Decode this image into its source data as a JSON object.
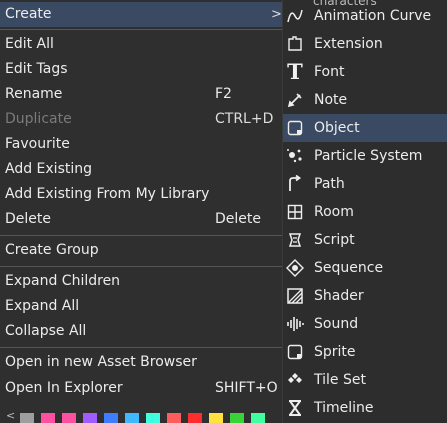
{
  "main_menu": {
    "create": "Create",
    "edit_all": "Edit All",
    "edit_tags": "Edit Tags",
    "rename": "Rename",
    "rename_sc": "F2",
    "duplicate": "Duplicate",
    "duplicate_sc": "CTRL+D",
    "favourite": "Favourite",
    "add_existing": "Add Existing",
    "add_existing_lib": "Add Existing From My Library",
    "delete": "Delete",
    "delete_sc": "Delete",
    "create_group": "Create Group",
    "expand_children": "Expand Children",
    "expand_all": "Expand All",
    "collapse_all": "Collapse All",
    "open_browser": "Open in new Asset Browser",
    "open_explorer": "Open In Explorer",
    "open_explorer_sc": "SHIFT+O"
  },
  "submenu_top_cut": "characters",
  "submenu": [
    {
      "label": "Animation Curve",
      "icon": "animation-curve-icon"
    },
    {
      "label": "Extension",
      "icon": "extension-icon"
    },
    {
      "label": "Font",
      "icon": "font-icon"
    },
    {
      "label": "Note",
      "icon": "note-icon"
    },
    {
      "label": "Object",
      "icon": "object-icon"
    },
    {
      "label": "Particle System",
      "icon": "particle-system-icon"
    },
    {
      "label": "Path",
      "icon": "path-icon"
    },
    {
      "label": "Room",
      "icon": "room-icon"
    },
    {
      "label": "Script",
      "icon": "script-icon"
    },
    {
      "label": "Sequence",
      "icon": "sequence-icon"
    },
    {
      "label": "Shader",
      "icon": "shader-icon"
    },
    {
      "label": "Sound",
      "icon": "sound-icon"
    },
    {
      "label": "Sprite",
      "icon": "sprite-icon"
    },
    {
      "label": "Tile Set",
      "icon": "tile-set-icon"
    },
    {
      "label": "Timeline",
      "icon": "timeline-icon"
    }
  ],
  "colors": [
    "#9e9e9e",
    "#ff4fa0",
    "#ff4fa0",
    "#a05cff",
    "#3f7cff",
    "#3fb8ff",
    "#3fffe0",
    "#ff5c5c",
    "#ff2e2e",
    "#ffe23f",
    "#39d339",
    "#3fffa0"
  ]
}
